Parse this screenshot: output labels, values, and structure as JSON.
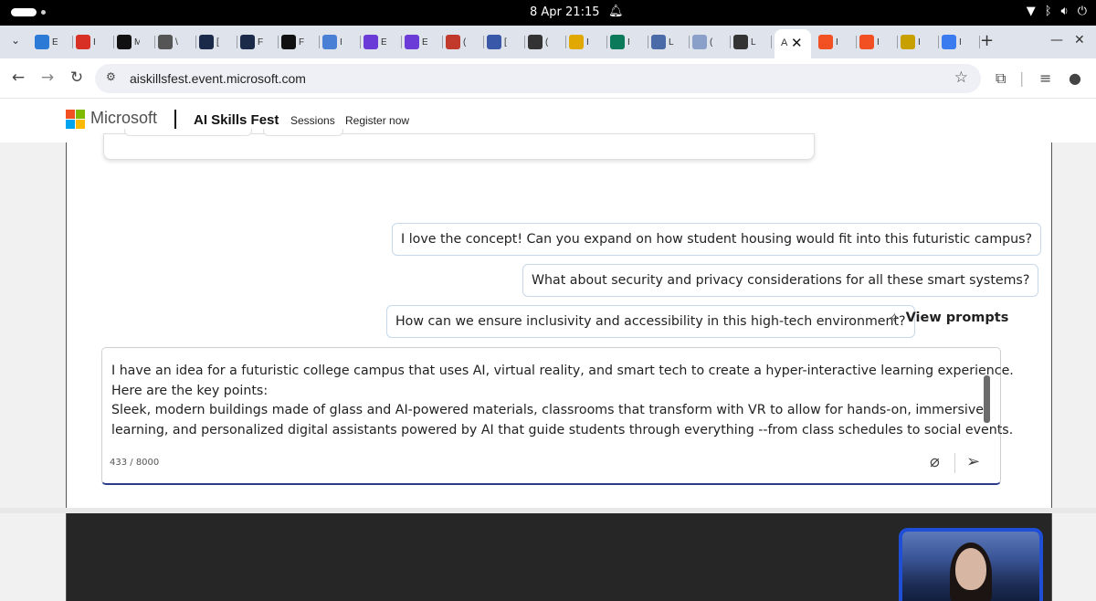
{
  "os": {
    "clock": "8 Apr  21:15"
  },
  "browser": {
    "tabs": [
      {
        "label": "E",
        "icon": "vscode-icon",
        "color": "#2b7bd6"
      },
      {
        "label": "I",
        "icon": "gmail-icon",
        "color": "#d93025"
      },
      {
        "label": "M",
        "icon": "medium-icon",
        "color": "#111111"
      },
      {
        "label": "\\",
        "icon": "globe-icon",
        "color": "#555555"
      },
      {
        "label": "[",
        "icon": "app-icon",
        "color": "#1a2a48"
      },
      {
        "label": "F",
        "icon": "app-icon",
        "color": "#1a2a48"
      },
      {
        "label": "F",
        "icon": "notion-icon",
        "color": "#111111"
      },
      {
        "label": "I",
        "icon": "puzzle-icon",
        "color": "#4a7fd6"
      },
      {
        "label": "E",
        "icon": "brand-icon",
        "color": "#6a3bd6"
      },
      {
        "label": "E",
        "icon": "brand-icon",
        "color": "#6a3bd6"
      },
      {
        "label": "(",
        "icon": "grid-icon",
        "color": "#c0392b"
      },
      {
        "label": "[",
        "icon": "circle-icon",
        "color": "#3a58a8"
      },
      {
        "label": "(",
        "icon": "c-icon",
        "color": "#333333"
      },
      {
        "label": "I",
        "icon": "star-icon",
        "color": "#e0a800"
      },
      {
        "label": "I",
        "icon": "terminal-icon",
        "color": "#0b7a5a"
      },
      {
        "label": "L",
        "icon": "globe-icon",
        "color": "#4a6aa8"
      },
      {
        "label": "(",
        "icon": "doc-icon",
        "color": "#8aa0c8"
      },
      {
        "label": "L",
        "icon": "lv-icon",
        "color": "#333333"
      }
    ],
    "active_tab": {
      "label": "A"
    },
    "tabs_after": [
      {
        "label": "I",
        "icon": "ms-icon",
        "color": "#f25022"
      },
      {
        "label": "I",
        "icon": "ms-icon",
        "color": "#f25022"
      },
      {
        "label": "I",
        "icon": "yellow-icon",
        "color": "#c8a000"
      },
      {
        "label": "I",
        "icon": "copilot-icon",
        "color": "#3b7bf0"
      }
    ],
    "url": "aiskillsfest.event.microsoft.com"
  },
  "site": {
    "brand": "Microsoft",
    "event_name": "AI Skills Fest",
    "nav": [
      "Sessions",
      "Register now"
    ],
    "logo_colors": [
      "#f25022",
      "#7fba00",
      "#00a4ef",
      "#ffb900"
    ]
  },
  "prompts": [
    "I love the concept! Can you expand on how student housing would fit into this futuristic campus?",
    "What about security and privacy considerations for all these smart systems?",
    "How can we ensure inclusivity and accessibility in this high-tech environment?"
  ],
  "view_prompts_label": "View prompts",
  "input": {
    "lines": [
      "I have an idea for a futuristic college campus that uses AI, virtual reality, and smart tech to create a hyper-interactive learning experience.",
      "Here are the key points:",
      "Sleek, modern buildings made of glass and AI-powered materials, classrooms that transform with VR to allow for hands-on, immersive",
      "learning, and personalized digital assistants powered by AI that guide students through everything --from class schedules to social events."
    ],
    "char_count": "433 / 8000"
  }
}
